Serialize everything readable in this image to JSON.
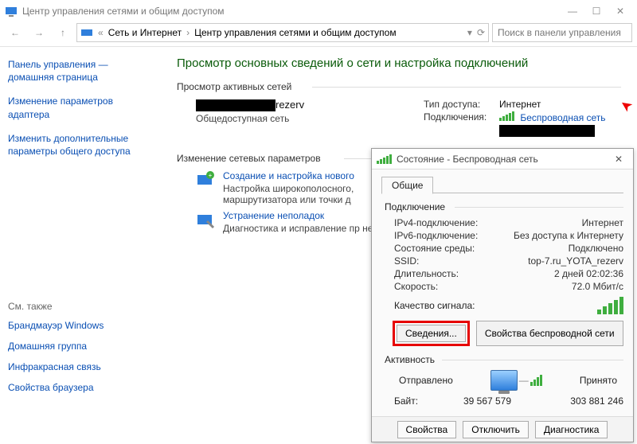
{
  "window": {
    "title": "Центр управления сетями и общим доступом"
  },
  "breadcrumb": {
    "root_icon": "network-icon",
    "items": [
      "Сеть и Интернет",
      "Центр управления сетями и общим доступом"
    ]
  },
  "search": {
    "placeholder": "Поиск в панели управления"
  },
  "sidebar": {
    "links": [
      "Панель управления — домашняя страница",
      "Изменение параметров адаптера",
      "Изменить дополнительные параметры общего доступа"
    ],
    "see_also_label": "См. также",
    "see_also": [
      "Брандмауэр Windows",
      "Домашняя группа",
      "Инфракрасная связь",
      "Свойства браузера"
    ]
  },
  "main": {
    "heading": "Просмотр основных сведений о сети и настройка подключений",
    "active_label": "Просмотр активных сетей",
    "network": {
      "name_suffix": "rezerv",
      "subtype": "Общедоступная сеть",
      "access_label": "Тип доступа:",
      "access_value": "Интернет",
      "conn_label": "Подключения:",
      "conn_value": "Беспроводная сеть"
    },
    "change_label": "Изменение сетевых параметров",
    "tasks": [
      {
        "title": "Создание и настройка нового",
        "desc": "Настройка широкополосного, маршрутизатора или точки д"
      },
      {
        "title": "Устранение неполадок",
        "desc": "Диагностика и исправление пр неполадок."
      }
    ]
  },
  "dialog": {
    "title": "Состояние - Беспроводная сеть",
    "tab_general": "Общие",
    "section_connection": "Подключение",
    "rows": {
      "ipv4_label": "IPv4-подключение:",
      "ipv4_value": "Интернет",
      "ipv6_label": "IPv6-подключение:",
      "ipv6_value": "Без доступа к Интернету",
      "media_label": "Состояние среды:",
      "media_value": "Подключено",
      "ssid_label": "SSID:",
      "ssid_value": "top-7.ru_YOTA_rezerv",
      "duration_label": "Длительность:",
      "duration_value": "2 дней 02:02:36",
      "speed_label": "Скорость:",
      "speed_value": "72.0 Мбит/с",
      "signal_label": "Качество сигнала:"
    },
    "btn_details": "Сведения...",
    "btn_wprops": "Свойства беспроводной сети",
    "section_activity": "Активность",
    "activity": {
      "sent_label": "Отправлено",
      "recv_label": "Принято",
      "bytes_label": "Байт:",
      "sent_value": "39 567 579",
      "recv_value": "303 881 246"
    },
    "bottom": {
      "properties": "Свойства",
      "disable": "Отключить",
      "diagnose": "Диагностика"
    }
  }
}
